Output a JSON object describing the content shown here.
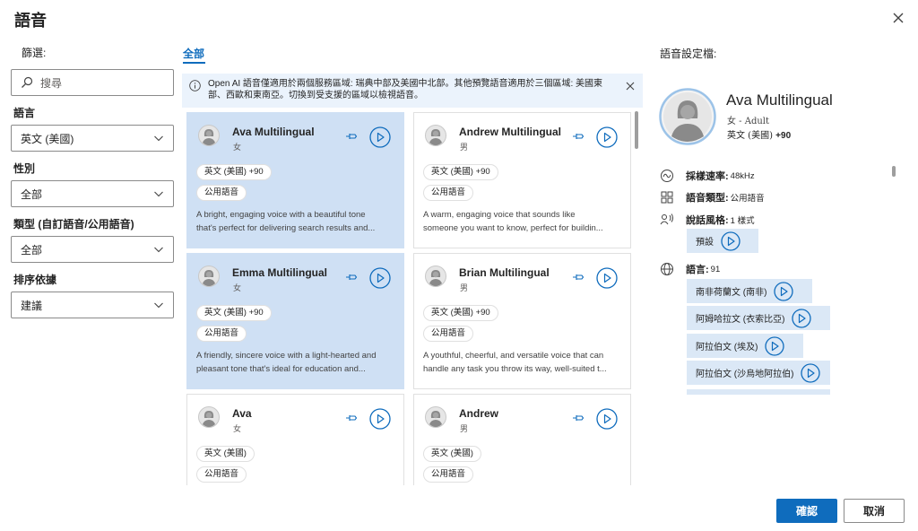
{
  "dialog": {
    "title": "語音",
    "confirm": "確認",
    "cancel": "取消"
  },
  "filters": {
    "label": "篩選:",
    "search_placeholder": "搜尋",
    "language_label": "語言",
    "language_value": "英文 (美國)",
    "gender_label": "性別",
    "gender_value": "全部",
    "type_label": "類型 (自訂語音/公用語音)",
    "type_value": "全部",
    "sort_label": "排序依據",
    "sort_value": "建議"
  },
  "tabs": [
    {
      "label": "全部",
      "active": true
    }
  ],
  "info_message": "Open AI 語音僅適用於兩個服務區域: 瑞典中部及美國中北部。其他預覽語音適用於三個區域: 美國東部、西歐和東南亞。切換到受支援的區域以檢視語音。",
  "voices": [
    {
      "name": "Ava Multilingual",
      "gender": "女",
      "lang_pill": "英文 (美國) +90",
      "type_pill": "公用語音",
      "desc1": "A bright, engaging voice with a beautiful tone",
      "desc2": "that's perfect for delivering search results and...",
      "selected": true
    },
    {
      "name": "Andrew Multilingual",
      "gender": "男",
      "lang_pill": "英文 (美國) +90",
      "type_pill": "公用語音",
      "desc1": "A warm, engaging voice that sounds like",
      "desc2": "someone you want to know, perfect for buildin...",
      "selected": false
    },
    {
      "name": "Emma Multilingual",
      "gender": "女",
      "lang_pill": "英文 (美國) +90",
      "type_pill": "公用語音",
      "desc1": "A friendly, sincere voice with a light-hearted and",
      "desc2": "pleasant tone that's ideal for education and...",
      "selected": true
    },
    {
      "name": "Brian Multilingual",
      "gender": "男",
      "lang_pill": "英文 (美國) +90",
      "type_pill": "公用語音",
      "desc1": "A youthful, cheerful, and versatile voice that can",
      "desc2": "handle any task you throw its way, well-suited t...",
      "selected": false
    },
    {
      "name": "Ava",
      "gender": "女",
      "lang_pill": "英文 (美國)",
      "type_pill": "公用語音",
      "desc1": "",
      "desc2": "",
      "selected": false
    },
    {
      "name": "Andrew",
      "gender": "男",
      "lang_pill": "英文 (美國)",
      "type_pill": "公用語音",
      "desc1": "",
      "desc2": "",
      "selected": false
    }
  ],
  "profile": {
    "heading": "語音設定檔:",
    "name": "Ava Multilingual",
    "subtitle": "女 - Adult",
    "lang": "英文 (美國)",
    "lang_more": "+90",
    "sample_rate_label": "採樣速率:",
    "sample_rate_value": "48kHz",
    "voice_type_label": "語音類型:",
    "voice_type_value": "公用語音",
    "style_label": "說話風格:",
    "style_value": "1 樣式",
    "style_default": "預設",
    "languages_label": "語言:",
    "languages_value": "91",
    "languages": [
      "南非荷蘭文 (南非)",
      "阿姆哈拉文 (衣索比亞)",
      "阿拉伯文 (埃及)",
      "阿拉伯文 (沙烏地阿拉伯)"
    ]
  },
  "colors": {
    "accent": "#0f6cbd",
    "selected_card": "#cfe0f4",
    "info_bg": "#ebf3fc"
  }
}
